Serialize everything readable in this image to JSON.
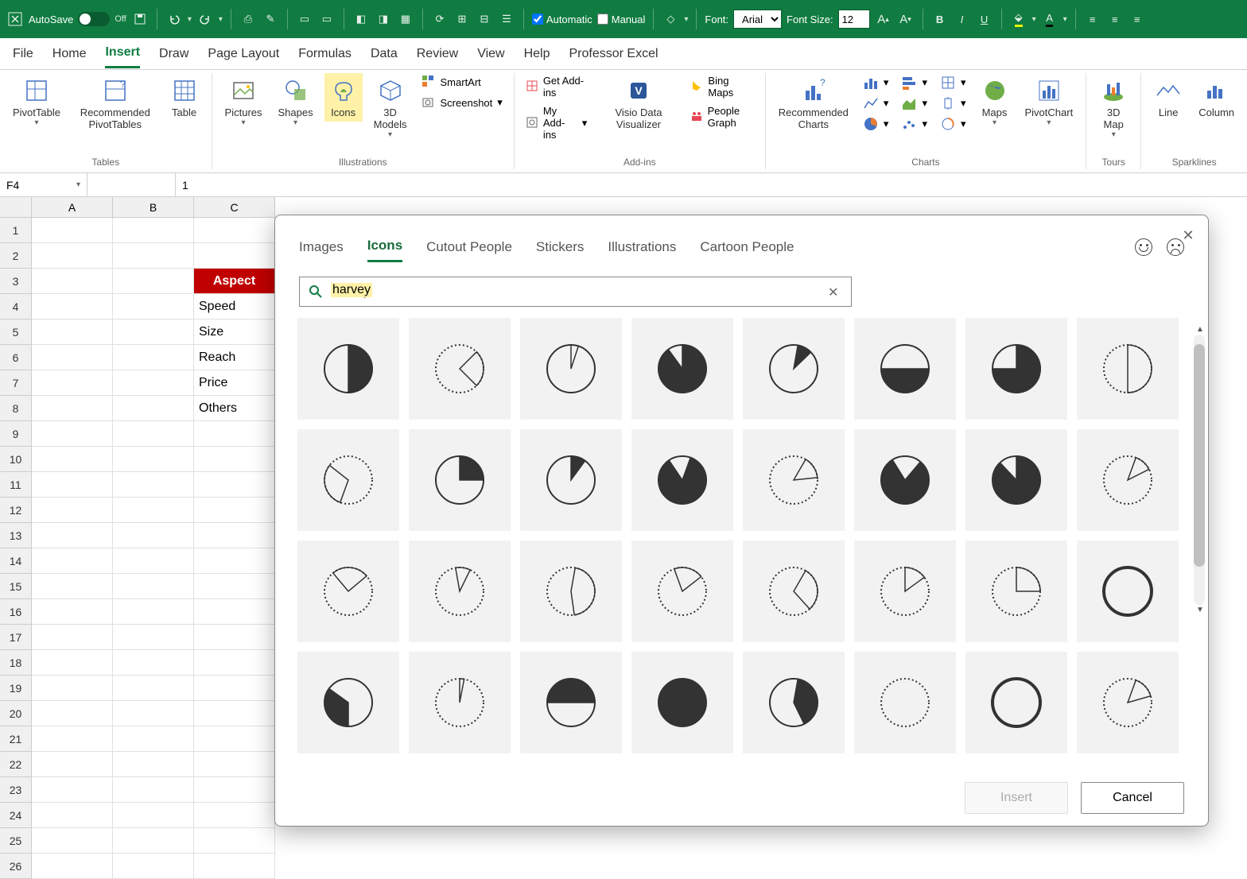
{
  "toolbar": {
    "autosave_label": "AutoSave",
    "autosave_state": "Off",
    "automatic_label": "Automatic",
    "manual_label": "Manual",
    "font_label": "Font:",
    "font_value": "Arial",
    "font_size_label": "Font Size:",
    "font_size_value": "12"
  },
  "tabs": [
    "File",
    "Home",
    "Insert",
    "Draw",
    "Page Layout",
    "Formulas",
    "Data",
    "Review",
    "View",
    "Help",
    "Professor Excel"
  ],
  "active_tab": "Insert",
  "ribbon_groups": {
    "tables": {
      "label": "Tables",
      "items": [
        "PivotTable",
        "Recommended PivotTables",
        "Table"
      ]
    },
    "illustrations": {
      "label": "Illustrations",
      "items": [
        "Pictures",
        "Shapes",
        "Icons",
        "3D Models"
      ],
      "smartart": "SmartArt",
      "screenshot": "Screenshot"
    },
    "addins": {
      "label": "Add-ins",
      "get": "Get Add-ins",
      "my": "My Add-ins",
      "visio": "Visio Data Visualizer",
      "bing": "Bing Maps",
      "people": "People Graph"
    },
    "charts": {
      "label": "Charts",
      "recommended": "Recommended Charts",
      "maps": "Maps",
      "pivot": "PivotChart"
    },
    "tours": {
      "label": "Tours",
      "map3d": "3D Map"
    },
    "sparklines": {
      "label": "Sparklines",
      "line": "Line",
      "column": "Column"
    }
  },
  "formula_bar": {
    "cell_ref": "F4",
    "value": "1"
  },
  "sheet": {
    "columns": [
      "A",
      "B",
      "C"
    ],
    "rows": 26,
    "data_col": "C",
    "cells": {
      "C3": "Aspect",
      "C4": "Speed",
      "C5": "Size",
      "C6": "Reach",
      "C7": "Price",
      "C8": "Others"
    }
  },
  "dialog": {
    "tabs": [
      "Images",
      "Icons",
      "Cutout People",
      "Stickers",
      "Illustrations",
      "Cartoon People"
    ],
    "active_tab": "Icons",
    "search_value": "harvey",
    "insert_label": "Insert",
    "cancel_label": "Cancel",
    "icon_rows": 4,
    "icon_cols": 8
  }
}
